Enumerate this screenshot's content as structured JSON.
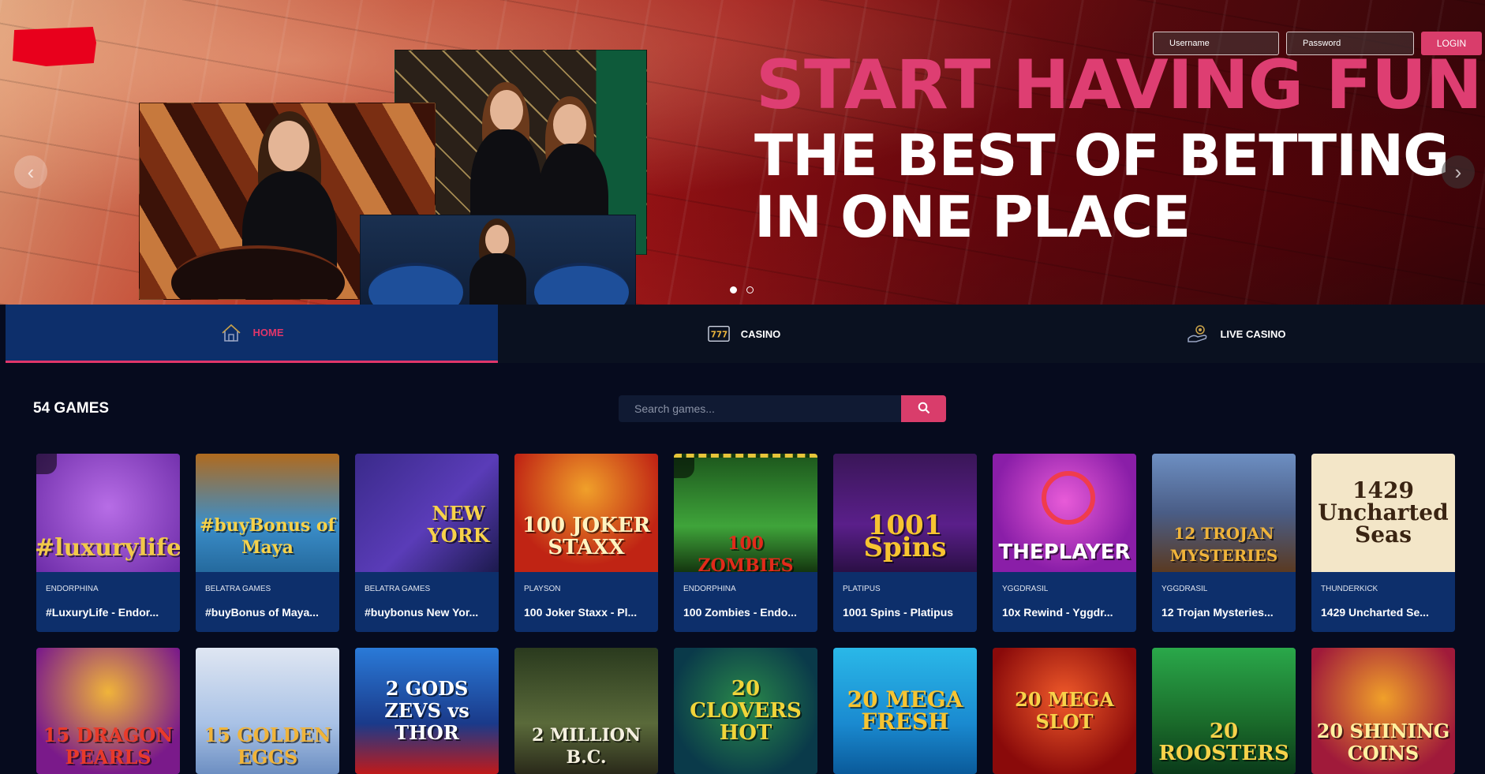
{
  "brand": {
    "logo_color": "#e8001c",
    "accent": "#d93d6b"
  },
  "hero": {
    "title_line1": "START HAVING FUN",
    "title_line2": "THE BEST OF BETTING IN ONE PLACE",
    "prev_icon": "chevron-left-icon",
    "next_icon": "chevron-right-icon",
    "slides_total": 2,
    "slide_active": 1
  },
  "login": {
    "username_placeholder": "Username",
    "password_placeholder": "Password",
    "button_label": "LOGIN"
  },
  "nav": {
    "items": [
      {
        "label": "HOME",
        "icon": "home-icon",
        "active": true
      },
      {
        "label": "CASINO",
        "icon": "slot-machine-icon",
        "active": false
      },
      {
        "label": "LIVE CASINO",
        "icon": "live-dealer-icon",
        "active": false
      }
    ]
  },
  "games_header": {
    "count_label": "54 GAMES",
    "search_placeholder": "Search games...",
    "search_icon": "search-icon"
  },
  "games": [
    {
      "provider": "ENDORPHINA",
      "name": "#LuxuryLife - Endor...",
      "art": "#luxurylife"
    },
    {
      "provider": "BELATRA GAMES",
      "name": "#buyBonus of Maya...",
      "art": "#buyBonus of Maya"
    },
    {
      "provider": "BELATRA GAMES",
      "name": "#buybonus New Yor...",
      "art": "NEW YORK"
    },
    {
      "provider": "PLAYSON",
      "name": "100 Joker Staxx - Pl...",
      "art": "100 JOKER STAXX"
    },
    {
      "provider": "ENDORPHINA",
      "name": "100 Zombies - Endo...",
      "art": "100 ZOMBIES"
    },
    {
      "provider": "PLATIPUS",
      "name": "1001 Spins - Platipus",
      "art": "1001 Spins"
    },
    {
      "provider": "YGGDRASIL",
      "name": "10x Rewind - Yggdr...",
      "art": "THEPLAYER"
    },
    {
      "provider": "YGGDRASIL",
      "name": "12 Trojan Mysteries...",
      "art": "12 TROJAN MYSTERIES"
    },
    {
      "provider": "THUNDERKICK",
      "name": "1429 Uncharted Se...",
      "art": "1429 Uncharted Seas"
    }
  ],
  "games_row2": [
    {
      "art": "15 DRAGON PEARLS"
    },
    {
      "art": "15 GOLDEN EGGS"
    },
    {
      "art": "2 GODS ZEVS vs THOR"
    },
    {
      "art": "2 MILLION B.C."
    },
    {
      "art": "20 CLOVERS HOT"
    },
    {
      "art": "20 MEGA FRESH"
    },
    {
      "art": "20 MEGA SLOT"
    },
    {
      "art": "20 ROOSTERS"
    },
    {
      "art": "20 SHINING COINS"
    }
  ]
}
